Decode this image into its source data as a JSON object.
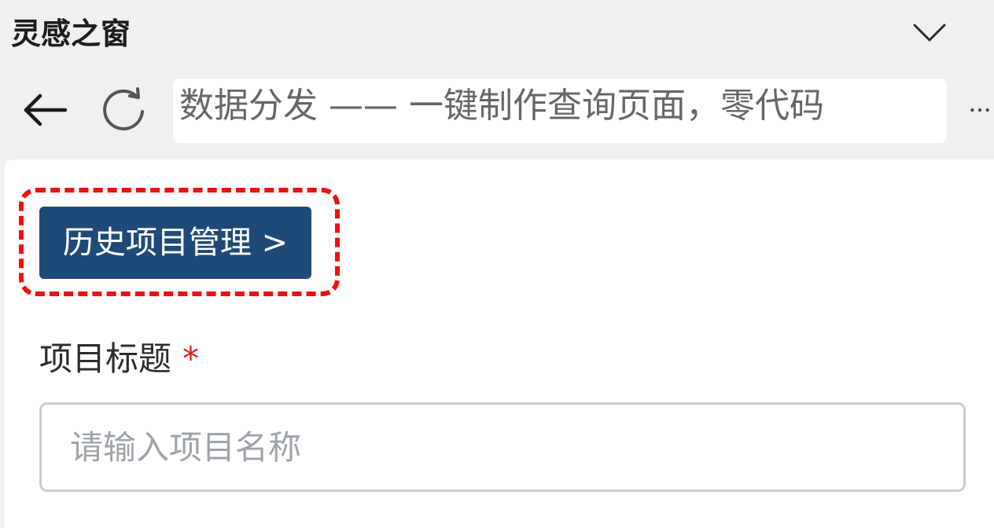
{
  "app": {
    "title": "灵感之窗"
  },
  "nav": {
    "address_text": "数据分发 —— 一键制作查询页面，零代码"
  },
  "main": {
    "history_button_label": "历史项目管理 >",
    "field_label": "项目标题",
    "required_mark": "*",
    "title_input_placeholder": "请输入项目名称",
    "title_input_value": ""
  },
  "icons": {
    "collapse": "chevron-down-icon",
    "back": "arrow-left-icon",
    "reload": "reload-icon",
    "more": "more-icon"
  },
  "colors": {
    "primary_button": "#1f4a78",
    "highlight": "#f10e0e",
    "required": "#e02020"
  }
}
